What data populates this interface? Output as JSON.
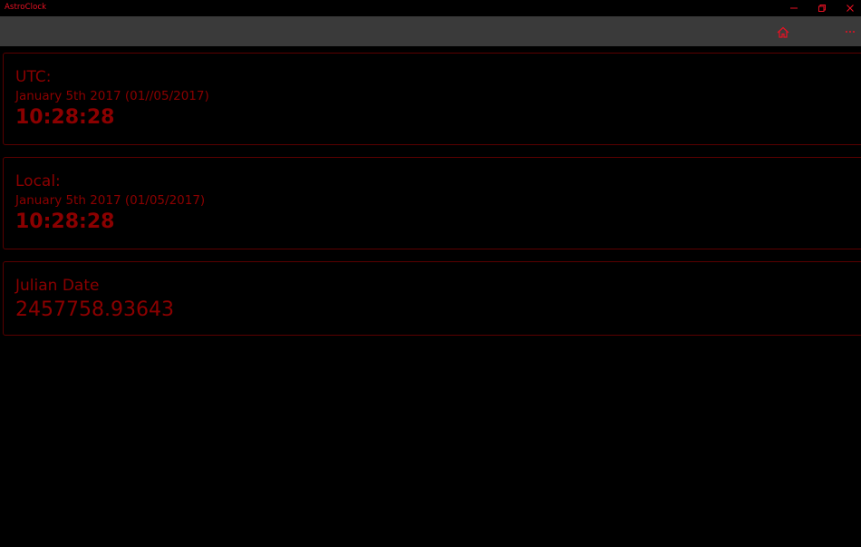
{
  "window": {
    "title": "AstroClock"
  },
  "icons": {
    "minimize": "minimize-icon",
    "restore": "restore-icon",
    "close": "close-icon",
    "home": "home-icon",
    "more": "more-icon"
  },
  "colors": {
    "background": "#000000",
    "appbar": "#3a3a3a",
    "accent": "#e81123",
    "text": "#8b0000",
    "card_border": "#5a0000"
  },
  "cards": {
    "utc": {
      "label": "UTC:",
      "date": "January 5th 2017 (01//05/2017)",
      "time": "10:28:28"
    },
    "local": {
      "label": "Local:",
      "date": "January 5th 2017 (01/05/2017)",
      "time": "10:28:28"
    },
    "julian": {
      "label": "Julian Date",
      "value": "2457758.93643"
    }
  }
}
